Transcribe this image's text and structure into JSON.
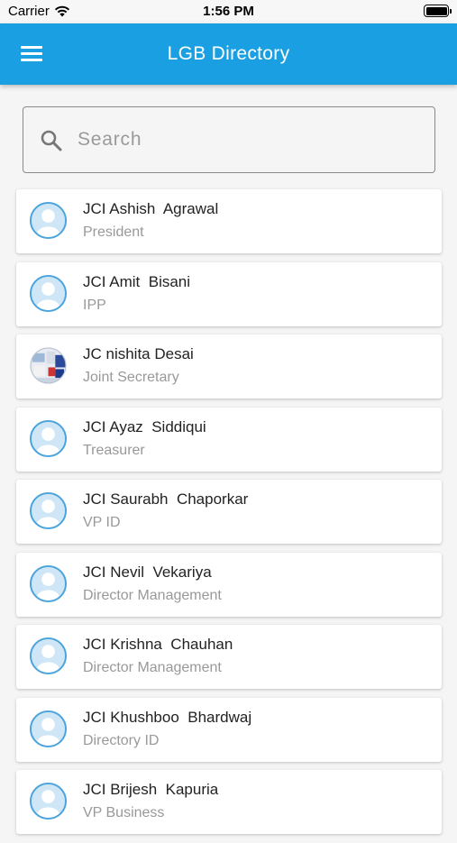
{
  "status_bar": {
    "carrier": "Carrier",
    "time": "1:56 PM",
    "wifi_icon": "wifi-icon",
    "battery_icon": "battery-icon"
  },
  "app_bar": {
    "title": "LGB Directory",
    "menu_icon": "hamburger-menu-icon",
    "color": "#1aa0e2"
  },
  "search": {
    "placeholder": "Search",
    "value": "",
    "icon": "search-icon"
  },
  "members": [
    {
      "name": "JCI Ashish  Agrawal",
      "role": "President",
      "avatar": "default"
    },
    {
      "name": "JCI Amit  Bisani",
      "role": "IPP",
      "avatar": "default"
    },
    {
      "name": "JC nishita Desai",
      "role": "Joint Secretary",
      "avatar": "photo"
    },
    {
      "name": "JCI Ayaz  Siddiqui",
      "role": "Treasurer",
      "avatar": "default"
    },
    {
      "name": "JCI Saurabh  Chaporkar",
      "role": "VP ID",
      "avatar": "default"
    },
    {
      "name": "JCI Nevil  Vekariya",
      "role": "Director Management",
      "avatar": "default"
    },
    {
      "name": "JCI Krishna  Chauhan",
      "role": "Director Management",
      "avatar": "default"
    },
    {
      "name": "JCI Khushboo  Bhardwaj",
      "role": "Directory ID",
      "avatar": "default"
    },
    {
      "name": "JCI Brijesh  Kapuria",
      "role": "VP Business",
      "avatar": "default"
    }
  ]
}
